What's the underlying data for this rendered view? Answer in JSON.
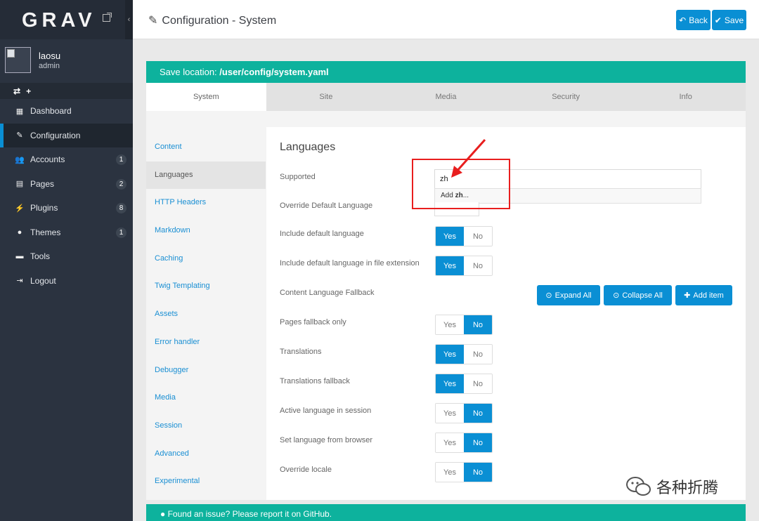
{
  "app": {
    "logo": "GRAV"
  },
  "user": {
    "name": "laosu",
    "role": "admin"
  },
  "sidebar": {
    "quick": [
      "⇄",
      "+"
    ],
    "items": [
      {
        "label": "Dashboard",
        "icon": "dashboard-icon",
        "glyph": "▦"
      },
      {
        "label": "Configuration",
        "icon": "wrench-icon",
        "glyph": "✎"
      },
      {
        "label": "Accounts",
        "icon": "users-icon",
        "glyph": "👥",
        "badge": "1"
      },
      {
        "label": "Pages",
        "icon": "file-icon",
        "glyph": "▤",
        "badge": "2"
      },
      {
        "label": "Plugins",
        "icon": "plug-icon",
        "glyph": "⚡",
        "badge": "8"
      },
      {
        "label": "Themes",
        "icon": "drop-icon",
        "glyph": "●",
        "badge": "1"
      },
      {
        "label": "Tools",
        "icon": "toolbox-icon",
        "glyph": "▬"
      },
      {
        "label": "Logout",
        "icon": "logout-icon",
        "glyph": "⇥"
      }
    ]
  },
  "header": {
    "title": "Configuration - System",
    "back_label": "Back",
    "save_label": "Save"
  },
  "save_location": {
    "prefix": "Save location: ",
    "path": "/user/config/system.yaml"
  },
  "tabs": [
    "System",
    "Site",
    "Media",
    "Security",
    "Info"
  ],
  "subnav": [
    "Content",
    "Languages",
    "HTTP Headers",
    "Markdown",
    "Caching",
    "Twig Templating",
    "Assets",
    "Error handler",
    "Debugger",
    "Media",
    "Session",
    "Advanced",
    "Experimental"
  ],
  "languages": {
    "title": "Languages",
    "supported_label": "Supported",
    "supported_value": "zh",
    "suggest_prefix": "Add ",
    "suggest_value": "zh",
    "suggest_suffix": "...",
    "override_label": "Override Default Language",
    "include_default_label": "Include default language",
    "include_ext_label": "Include default language in file extension",
    "fallback_label": "Content Language Fallback",
    "expand_all": "Expand All",
    "collapse_all": "Collapse All",
    "add_item": "Add item",
    "pages_fallback_label": "Pages fallback only",
    "translations_label": "Translations",
    "translations_fallback_label": "Translations fallback",
    "active_session_label": "Active language in session",
    "browser_label": "Set language from browser",
    "override_locale_label": "Override locale",
    "yes": "Yes",
    "no": "No"
  },
  "footer": {
    "text": "Found an issue? Please report it on GitHub."
  },
  "watermark": {
    "text": "各种折腾"
  },
  "colors": {
    "accent": "#0a8fd4",
    "teal": "#0db29d",
    "sidebar": "#2b3340",
    "annotation": "#e81e1e"
  }
}
